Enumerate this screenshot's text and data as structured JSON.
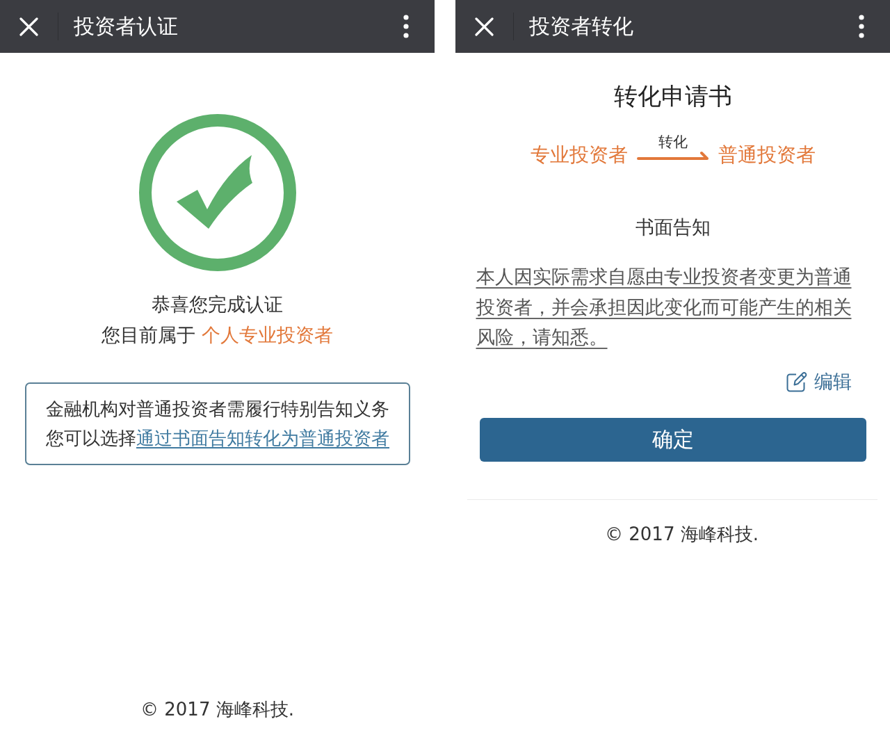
{
  "certification_screen": {
    "header": {
      "title": "投资者认证"
    },
    "message": "恭喜您完成认证",
    "status": {
      "label": "您目前属于",
      "value": "个人专业投资者"
    },
    "notice": {
      "text": "金融机构对普通投资者需履行特别告知义务",
      "prompt": "您可以选择",
      "link": "通过书面告知转化为普通投资者"
    },
    "footer": "© 2017 海峰科技."
  },
  "conversion_screen": {
    "header": {
      "title": "投资者转化"
    },
    "title": "转化申请书",
    "conversion": {
      "from": "专业投资者",
      "label": "转化",
      "to": "普通投资者"
    },
    "section_title": "书面告知",
    "statement": "本人因实际需求自愿由专业投资者变更为普通投资者，并会承担因此变化而可能产生的相关风险，请知悉。",
    "edit_link": "编辑",
    "confirm_button": "确定",
    "footer": "© 2017 海峰科技."
  }
}
